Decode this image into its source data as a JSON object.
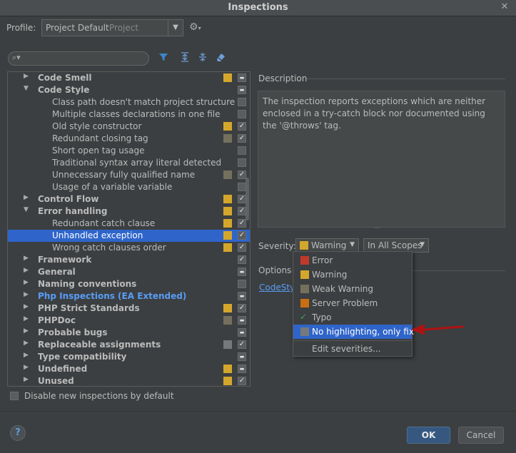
{
  "window": {
    "title": "Inspections",
    "close_icon": "close-icon"
  },
  "profile": {
    "label": "Profile:",
    "name": "Project Default",
    "scope": "Project",
    "gear_icon": "gear-icon"
  },
  "toolbar": {
    "search_placeholder": "",
    "icons": [
      "filter-icon",
      "expand-all-icon",
      "collapse-all-icon",
      "clean-icon"
    ]
  },
  "colors": {
    "warning": "#d4a72c",
    "weak_warning": "#75705e",
    "error": "#c0392b",
    "server_problem": "#c96f12",
    "no_highlight": "#76797b",
    "selection": "#2f65ca",
    "link": "#589df6"
  },
  "tree": [
    {
      "label": "Code Smell",
      "indent": 0,
      "expandable": true,
      "expanded": false,
      "style": "bold",
      "severity": "warning",
      "check": "mixed"
    },
    {
      "label": "Code Style",
      "indent": 0,
      "expandable": true,
      "expanded": true,
      "style": "bold",
      "severity": null,
      "check": "mixed"
    },
    {
      "label": "Class path doesn't match project structure",
      "indent": 1,
      "expandable": false,
      "style": "normal",
      "severity": null,
      "check": "off"
    },
    {
      "label": "Multiple classes declarations in one file",
      "indent": 1,
      "expandable": false,
      "style": "normal",
      "severity": null,
      "check": "off"
    },
    {
      "label": "Old style constructor",
      "indent": 1,
      "expandable": false,
      "style": "normal",
      "severity": "warning",
      "check": "on"
    },
    {
      "label": "Redundant closing tag",
      "indent": 1,
      "expandable": false,
      "style": "normal",
      "severity": "weak_warning",
      "check": "on"
    },
    {
      "label": "Short open tag usage",
      "indent": 1,
      "expandable": false,
      "style": "normal",
      "severity": null,
      "check": "off"
    },
    {
      "label": "Traditional syntax array literal detected",
      "indent": 1,
      "expandable": false,
      "style": "normal",
      "severity": null,
      "check": "off"
    },
    {
      "label": "Unnecessary fully qualified name",
      "indent": 1,
      "expandable": false,
      "style": "normal",
      "severity": "weak_warning",
      "check": "on"
    },
    {
      "label": "Usage of a variable variable",
      "indent": 1,
      "expandable": false,
      "style": "normal",
      "severity": null,
      "check": "off"
    },
    {
      "label": "Control Flow",
      "indent": 0,
      "expandable": true,
      "expanded": false,
      "style": "bold",
      "severity": "warning",
      "check": "on"
    },
    {
      "label": "Error handling",
      "indent": 0,
      "expandable": true,
      "expanded": true,
      "style": "bold",
      "severity": "warning",
      "check": "on"
    },
    {
      "label": "Redundant catch clause",
      "indent": 1,
      "expandable": false,
      "style": "normal",
      "severity": "warning",
      "check": "on"
    },
    {
      "label": "Unhandled exception",
      "indent": 1,
      "expandable": false,
      "style": "normal",
      "severity": "warning",
      "check": "on",
      "selected": true
    },
    {
      "label": "Wrong catch clauses order",
      "indent": 1,
      "expandable": false,
      "style": "normal",
      "severity": "warning",
      "check": "on"
    },
    {
      "label": "Framework",
      "indent": 0,
      "expandable": true,
      "expanded": false,
      "style": "bold",
      "severity": null,
      "check": "on"
    },
    {
      "label": "General",
      "indent": 0,
      "expandable": true,
      "expanded": false,
      "style": "bold",
      "severity": null,
      "check": "mixed"
    },
    {
      "label": "Naming conventions",
      "indent": 0,
      "expandable": true,
      "expanded": false,
      "style": "bold",
      "severity": null,
      "check": "off"
    },
    {
      "label": "Php Inspections (EA Extended)",
      "indent": 0,
      "expandable": true,
      "expanded": false,
      "style": "blue",
      "severity": null,
      "check": "mixed"
    },
    {
      "label": "PHP Strict Standards",
      "indent": 0,
      "expandable": true,
      "expanded": false,
      "style": "bold",
      "severity": "warning",
      "check": "on"
    },
    {
      "label": "PHPDoc",
      "indent": 0,
      "expandable": true,
      "expanded": false,
      "style": "bold",
      "severity": "weak_warning",
      "check": "mixed"
    },
    {
      "label": "Probable bugs",
      "indent": 0,
      "expandable": true,
      "expanded": false,
      "style": "bold",
      "severity": null,
      "check": "mixed"
    },
    {
      "label": "Replaceable assignments",
      "indent": 0,
      "expandable": true,
      "expanded": false,
      "style": "bold",
      "severity": "no_highlight",
      "check": "on"
    },
    {
      "label": "Type compatibility",
      "indent": 0,
      "expandable": true,
      "expanded": false,
      "style": "bold",
      "severity": null,
      "check": "mixed"
    },
    {
      "label": "Undefined",
      "indent": 0,
      "expandable": true,
      "expanded": false,
      "style": "bold",
      "severity": "warning",
      "check": "mixed"
    },
    {
      "label": "Unused",
      "indent": 0,
      "expandable": true,
      "expanded": false,
      "style": "bold",
      "severity": "warning",
      "check": "on"
    }
  ],
  "disable_new": {
    "label": "Disable new inspections by default",
    "checked": false
  },
  "description": {
    "title": "Description",
    "text": "The inspection reports exceptions which are neither enclosed in a try-catch block nor documented using the '@throws' tag."
  },
  "severity": {
    "label": "Severity:",
    "selected": "Warning",
    "scope": "In All Scopes"
  },
  "options": {
    "title": "Options",
    "link": "CodeStyle"
  },
  "severity_menu": [
    {
      "label": "Error",
      "color": "error",
      "kind": "swatch"
    },
    {
      "label": "Warning",
      "color": "warning",
      "kind": "swatch"
    },
    {
      "label": "Weak Warning",
      "color": "weak_warning",
      "kind": "swatch"
    },
    {
      "label": "Server Problem",
      "color": "server_problem",
      "kind": "swatch"
    },
    {
      "label": "Typo",
      "color": null,
      "kind": "typo"
    },
    {
      "label": "No highlighting, only fix",
      "color": "no_highlight",
      "kind": "swatch",
      "selected": true
    },
    {
      "label": "Edit severities...",
      "color": null,
      "kind": "edit"
    }
  ],
  "buttons": {
    "help": "?",
    "ok": "OK",
    "cancel": "Cancel"
  }
}
